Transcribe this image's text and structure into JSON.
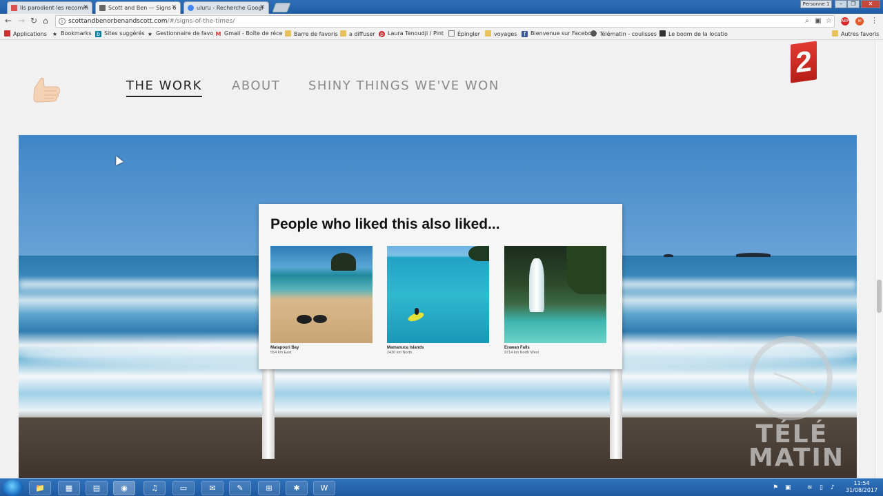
{
  "browser": {
    "tabs": [
      {
        "title": "Ils parodient les recomm",
        "fav_color": "#d9534f"
      },
      {
        "title": "Scott and Ben — Signs o",
        "fav_color": "#666666"
      },
      {
        "title": "uluru - Recherche Googl",
        "fav_color": "#4285f4"
      }
    ],
    "profile": "Personne 1",
    "url_main": "scottandbenorbenandscott.com",
    "url_path": "/#/signs-of-the-times/",
    "bookmarks": [
      {
        "label": "Applications",
        "icon": "apps-grid-icon"
      },
      {
        "label": "Bookmarks",
        "icon": "star-icon"
      },
      {
        "label": "Sites suggérés",
        "icon": "bing-icon"
      },
      {
        "label": "Gestionnaire de favo",
        "icon": "star-icon"
      },
      {
        "label": "Gmail - Boîte de réce",
        "icon": "gmail-icon"
      },
      {
        "label": "Barre de favoris",
        "icon": "folder-icon"
      },
      {
        "label": "a diffuser",
        "icon": "folder-icon"
      },
      {
        "label": "Laura Tenoudji / Pint",
        "icon": "pinterest-icon"
      },
      {
        "label": "Épingler",
        "icon": "page-icon"
      },
      {
        "label": "voyages",
        "icon": "folder-icon"
      },
      {
        "label": "Bienvenue sur Facebo",
        "icon": "facebook-icon"
      },
      {
        "label": "Télématin - coulisses",
        "icon": "page-icon"
      },
      {
        "label": "Le boom de la locatio",
        "icon": "page-icon"
      }
    ],
    "other_bookmarks": "Autres favoris"
  },
  "site": {
    "nav": [
      {
        "label": "THE WORK",
        "active": true
      },
      {
        "label": "ABOUT",
        "active": false
      },
      {
        "label": "SHINY THINGS WE'VE WON",
        "active": false
      }
    ],
    "sign": {
      "title": "People who liked this also liked...",
      "cards": [
        {
          "name": "Matapouri Bay",
          "distance": "554 km East"
        },
        {
          "name": "Mamanuca Islands",
          "distance": "2430 km North"
        },
        {
          "name": "Erawan Falls",
          "distance": "9714 km North West"
        }
      ]
    }
  },
  "overlay": {
    "channel_logo": "2",
    "watermark": "TÉLÉ MATIN"
  },
  "taskbar": {
    "time": "11:54",
    "date": "31/08/2017",
    "apps": [
      "explorer-icon",
      "apps-icon",
      "notes-icon",
      "chrome-icon",
      "itunes-icon",
      "folder-icon",
      "mail-icon",
      "paint-icon",
      "network-icon",
      "game-icon",
      "word-icon"
    ]
  }
}
